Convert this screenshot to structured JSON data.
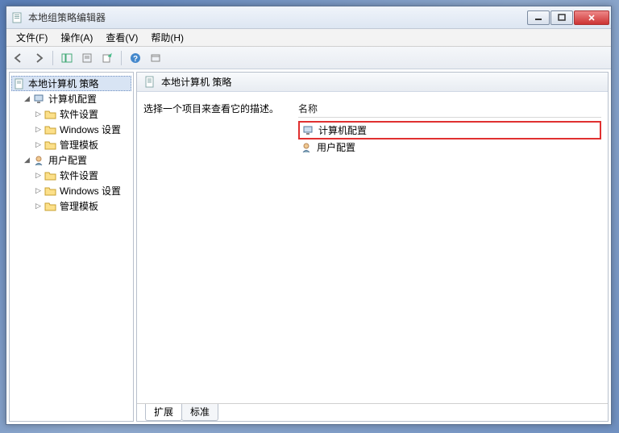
{
  "window": {
    "title": "本地组策略编辑器"
  },
  "menu": {
    "file": "文件(F)",
    "action": "操作(A)",
    "view": "查看(V)",
    "help": "帮助(H)"
  },
  "tree": {
    "root": "本地计算机 策略",
    "computer": "计算机配置",
    "user": "用户配置",
    "software": "软件设置",
    "windows": "Windows 设置",
    "templates": "管理模板"
  },
  "right": {
    "header": "本地计算机 策略",
    "desc": "选择一个项目来查看它的描述。",
    "colName": "名称",
    "item1": "计算机配置",
    "item2": "用户配置"
  },
  "tabs": {
    "extended": "扩展",
    "standard": "标准"
  }
}
